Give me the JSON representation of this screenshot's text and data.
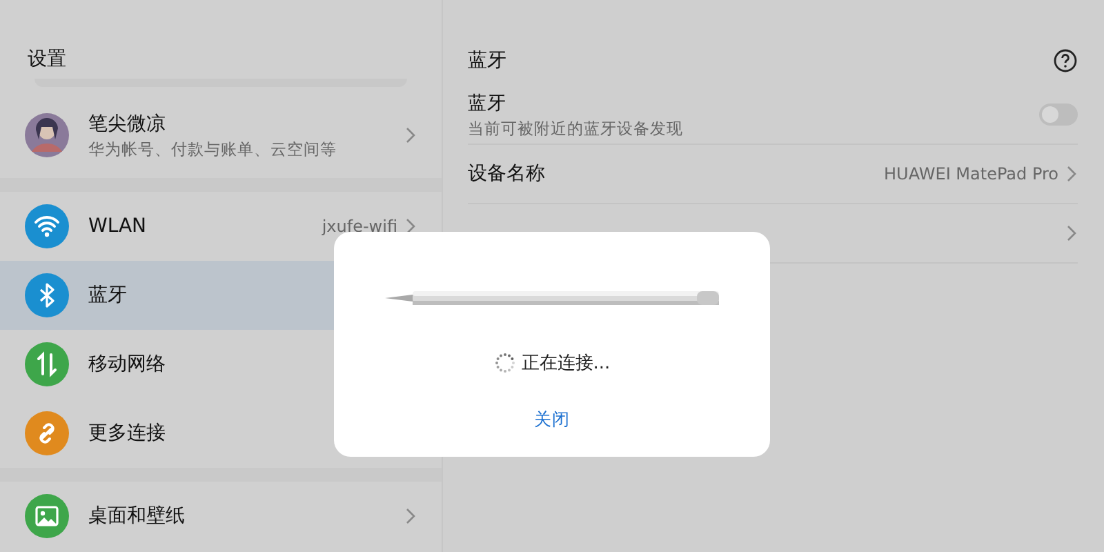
{
  "sidebar": {
    "title": "设置",
    "groups": [
      [
        {
          "kind": "profile",
          "label": "笔尖微凉",
          "subtitle": "华为帐号、付款与账单、云空间等",
          "chevron": true,
          "selected": false
        }
      ],
      [
        {
          "kind": "wifi",
          "label": "WLAN",
          "value": "jxufe-wifi",
          "chevron": true,
          "selected": false,
          "color": "#1a8fd0"
        },
        {
          "kind": "bluetooth",
          "label": "蓝牙",
          "chevron": false,
          "selected": true,
          "color": "#1a8fd0"
        },
        {
          "kind": "mobile",
          "label": "移动网络",
          "chevron": false,
          "selected": false,
          "color": "#3ea64a"
        },
        {
          "kind": "link",
          "label": "更多连接",
          "chevron": false,
          "selected": false,
          "color": "#e08a1e"
        }
      ],
      [
        {
          "kind": "wallpaper",
          "label": "桌面和壁纸",
          "chevron": true,
          "selected": false,
          "color": "#3ea64a"
        }
      ]
    ]
  },
  "detail": {
    "title": "蓝牙",
    "rows": [
      {
        "kind": "toggle",
        "label": "蓝牙",
        "subtitle": "当前可被附近的蓝牙设备发现",
        "on": false
      },
      {
        "kind": "link",
        "label": "设备名称",
        "value": "HUAWEI MatePad Pro"
      },
      {
        "kind": "link"
      }
    ]
  },
  "dialog": {
    "status": "正在连接...",
    "button": "关闭"
  }
}
